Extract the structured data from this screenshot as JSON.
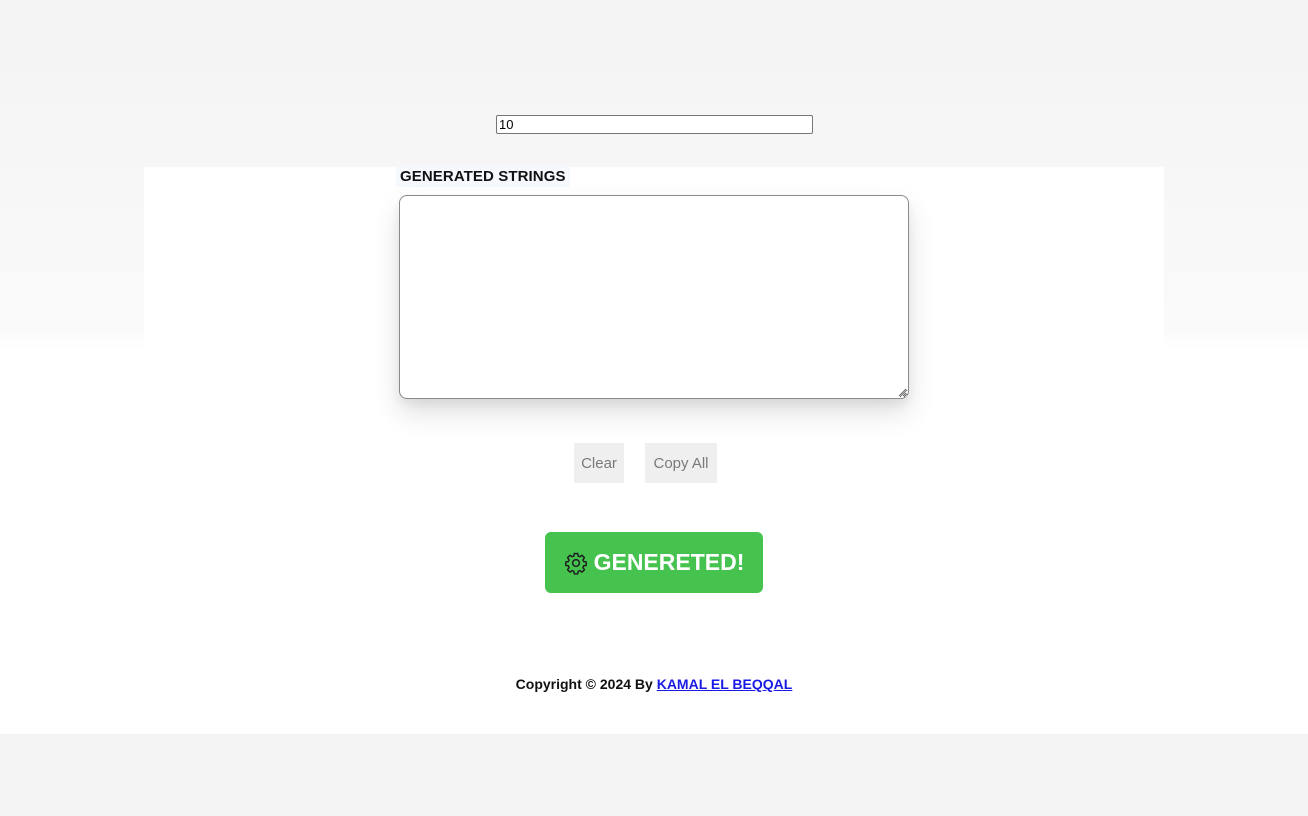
{
  "count_input": {
    "value": "10"
  },
  "generated": {
    "label": "GENERATED STRINGS",
    "value": ""
  },
  "actions": {
    "clear_label": "Clear",
    "copy_all_label": "Copy All"
  },
  "generate_button": {
    "label": "GENERETED!",
    "icon": "gear-icon",
    "color": "#46c24f"
  },
  "footer": {
    "prefix": "Copyright ©  2024 By ",
    "author": "KAMAL EL BEQQAL"
  }
}
